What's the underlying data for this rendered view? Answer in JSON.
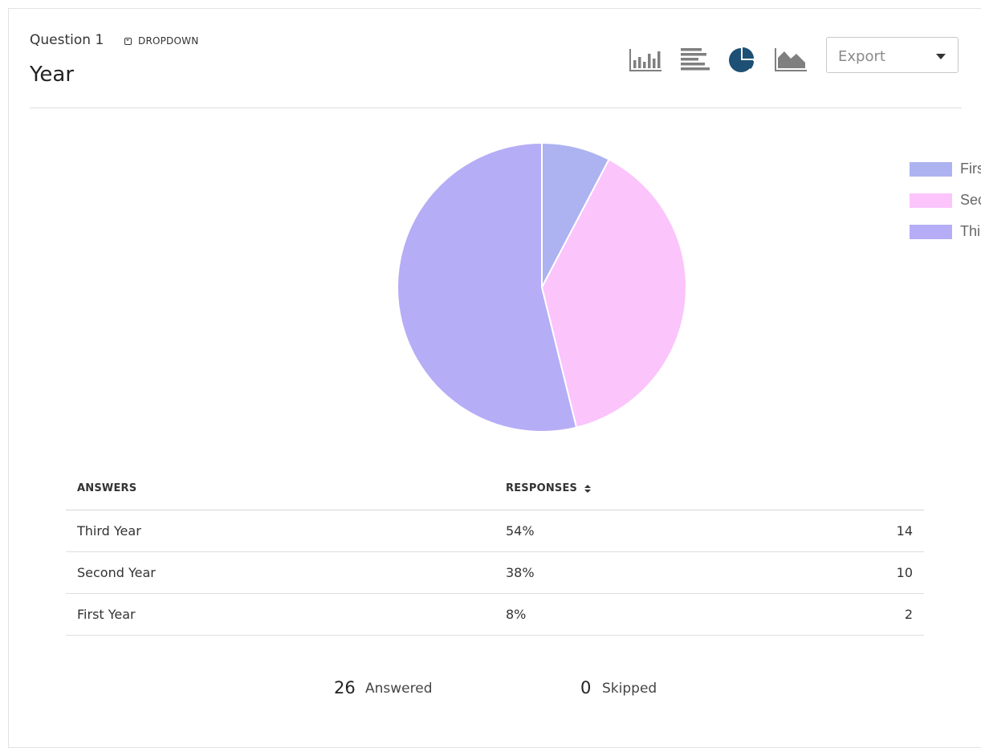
{
  "question": {
    "number_label": "Question 1",
    "type_label": "DROPDOWN",
    "title": "Year"
  },
  "toolbar": {
    "chart_buttons": [
      {
        "name": "vertical-bar-chart-icon",
        "active": false
      },
      {
        "name": "horizontal-bar-chart-icon",
        "active": false
      },
      {
        "name": "pie-chart-icon",
        "active": true
      },
      {
        "name": "area-chart-icon",
        "active": false
      }
    ],
    "export_label": "Export",
    "icon_color": "#7f7f7f",
    "active_icon_color": "#1e5075"
  },
  "chart_data": {
    "type": "pie",
    "labels": [
      "First Year",
      "Second Year",
      "Third Year"
    ],
    "values": [
      2,
      10,
      14
    ],
    "colors": [
      "#adb3f0",
      "#fbc4fb",
      "#b5adf6"
    ],
    "legend_position": "right"
  },
  "table": {
    "headers": {
      "answers": "ANSWERS",
      "responses": "RESPONSES"
    },
    "rows": [
      {
        "answer": "Third Year",
        "percent": "54%",
        "count": "14"
      },
      {
        "answer": "Second Year",
        "percent": "38%",
        "count": "10"
      },
      {
        "answer": "First Year",
        "percent": "8%",
        "count": "2"
      }
    ]
  },
  "summary": {
    "answered_count": "26",
    "answered_label": "Answered",
    "skipped_count": "0",
    "skipped_label": "Skipped"
  }
}
